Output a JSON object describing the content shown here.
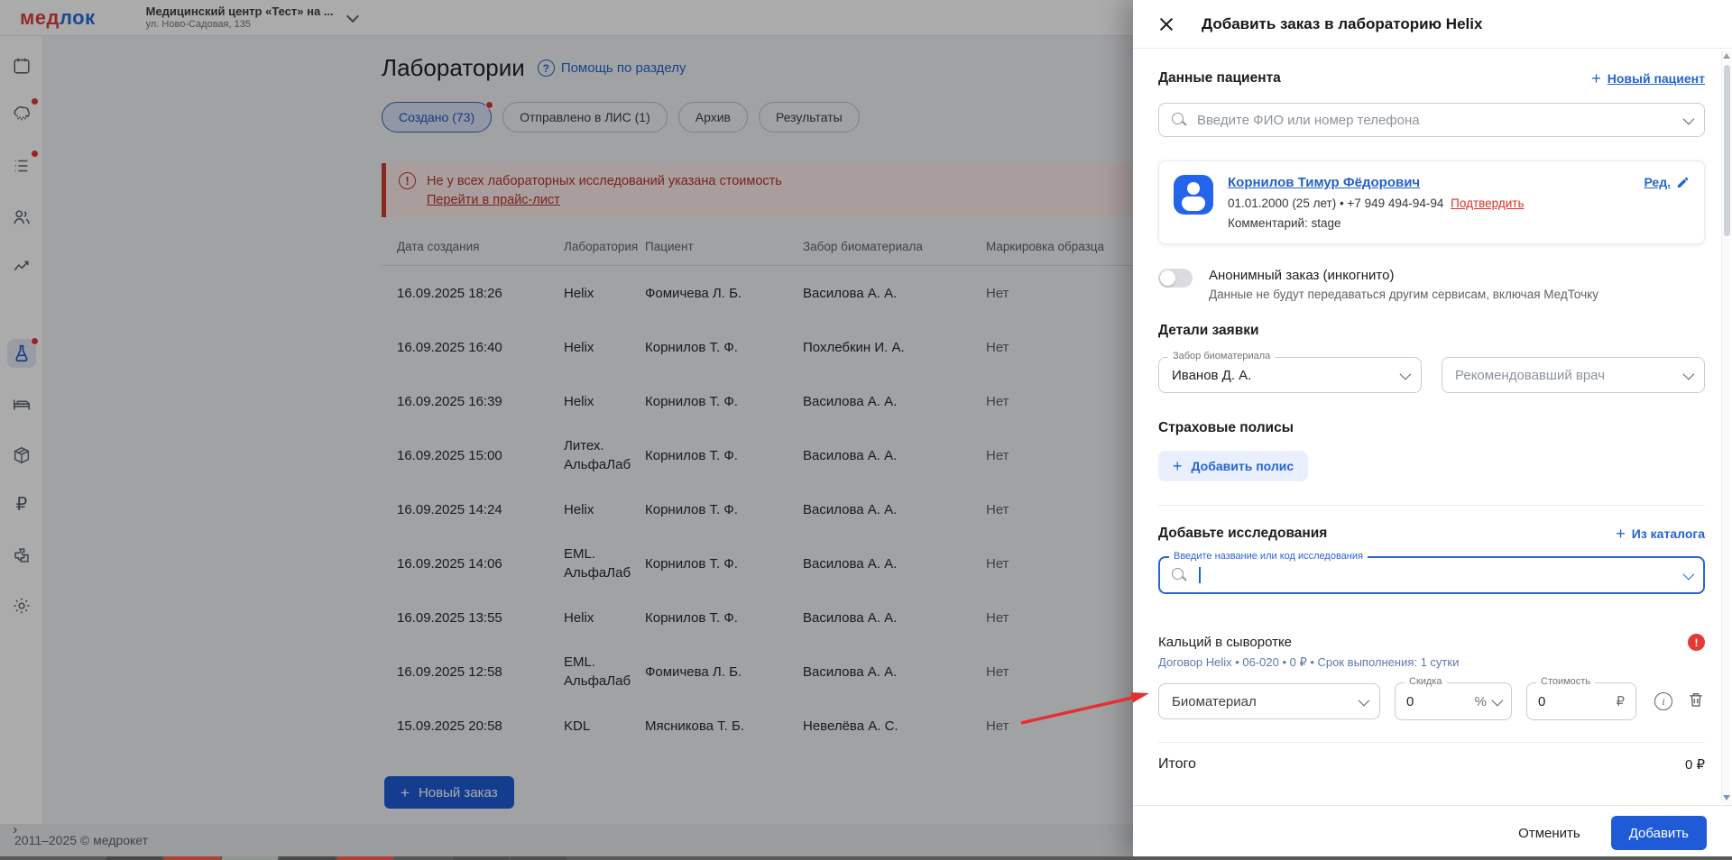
{
  "colors": {
    "accent_blue": "#1f5bd7",
    "link_blue": "#2465d0",
    "danger_red": "#d5372f",
    "logo_red": "#d94141",
    "logo_blue": "#2f6bd8",
    "selected_tab_bg": "#d9e1f5",
    "annotation_arrow": "#e53030"
  },
  "header": {
    "logo_red_part": "мед",
    "logo_blue_part": "лок",
    "clinic_name": "Медицинский центр «Тест» на ...",
    "clinic_address": "ул. Ново-Садовая, 135"
  },
  "sidebar": {
    "items": [
      "calendar",
      "crm",
      "tasks",
      "patients",
      "analytics",
      "laboratory",
      "ward",
      "stock",
      "finance",
      "integrations",
      "settings"
    ],
    "active_item": "laboratory"
  },
  "main": {
    "title": "Лаборатории",
    "help_link": "Помощь по разделу",
    "tabs": [
      {
        "label": "Создано (73)",
        "selected": true,
        "badge": true
      },
      {
        "label": "Отправлено в ЛИС (1)",
        "selected": false
      },
      {
        "label": "Архив",
        "selected": false
      },
      {
        "label": "Результаты",
        "selected": false
      }
    ],
    "warning": {
      "text": "Не у всех лабораторных исследований указана стоимость",
      "link": "Перейти в прайс-лист"
    },
    "table": {
      "columns": [
        "Дата создания",
        "Лаборатория",
        "Пациент",
        "Забор биоматериала",
        "Маркировка образца"
      ],
      "rows": [
        {
          "date": "16.09.2025 18:26",
          "lab": "Helix",
          "patient": "Фомичева Л. Б.",
          "collector": "Василова А. А.",
          "marking": "Нет"
        },
        {
          "date": "16.09.2025 16:40",
          "lab": "Helix",
          "patient": "Корнилов Т. Ф.",
          "collector": "Похлебкин И. А.",
          "marking": "Нет"
        },
        {
          "date": "16.09.2025 16:39",
          "lab": "Helix",
          "patient": "Корнилов Т. Ф.",
          "collector": "Василова А. А.",
          "marking": "Нет"
        },
        {
          "date": "16.09.2025 15:00",
          "lab": "Литех. АльфаЛаб",
          "patient": "Корнилов Т. Ф.",
          "collector": "Василова А. А.",
          "marking": "Нет"
        },
        {
          "date": "16.09.2025 14:24",
          "lab": "Helix",
          "patient": "Корнилов Т. Ф.",
          "collector": "Василова А. А.",
          "marking": "Нет"
        },
        {
          "date": "16.09.2025 14:06",
          "lab": "EML. АльфаЛаб",
          "patient": "Корнилов Т. Ф.",
          "collector": "Василова А. А.",
          "marking": "Нет"
        },
        {
          "date": "16.09.2025 13:55",
          "lab": "Helix",
          "patient": "Корнилов Т. Ф.",
          "collector": "Василова А. А.",
          "marking": "Нет"
        },
        {
          "date": "16.09.2025 12:58",
          "lab": "EML. АльфаЛаб",
          "patient": "Фомичева Л. Б.",
          "collector": "Василова А. А.",
          "marking": "Нет"
        },
        {
          "date": "15.09.2025 20:58",
          "lab": "KDL",
          "patient": "Мясникова Т. Б.",
          "collector": "Невелёва А. С.",
          "marking": "Нет"
        }
      ]
    },
    "new_order_button": "Новый заказ",
    "footer": "2011–2025 © медрокет"
  },
  "drawer": {
    "title": "Добавить заказ в лабораторию Helix",
    "patient": {
      "section_title": "Данные пациента",
      "new_patient_link": "Новый пациент",
      "search_placeholder": "Введите ФИО или номер телефона",
      "card": {
        "name": "Корнилов Тимур Фёдорович",
        "info": "01.01.2000 (25 лет) • +7 949 494-94-94",
        "confirm_link": "Подтвердить",
        "comment": "Комментарий: stage",
        "edit_link": "Ред."
      },
      "anonymous_label": "Анонимный заказ (инкогнито)",
      "anonymous_note": "Данные не будут передаваться другим сервисам, включая МедТочку"
    },
    "details": {
      "section_title": "Детали заявки",
      "biomaterial_label": "Забор биоматериала",
      "biomaterial_value": "Иванов Д. А.",
      "doctor_placeholder": "Рекомендовавший врач"
    },
    "insurance": {
      "section_title": "Страховые полисы",
      "add_button": "Добавить полис"
    },
    "research": {
      "section_title": "Добавьте исследования",
      "catalog_link": "Из каталога",
      "search_label": "Введите название или код исследования",
      "item": {
        "name": "Кальций в сыворотке",
        "meta": "Договор Helix • 06-020 • 0 ₽ • Срок выполнения: 1 сутки",
        "biomaterial_placeholder": "Биоматериал",
        "discount_label": "Скидка",
        "discount_value": "0",
        "discount_unit": "%",
        "cost_label": "Стоимость",
        "cost_value": "0",
        "currency": "₽"
      }
    },
    "total": {
      "label": "Итого",
      "value": "0 ₽"
    },
    "footer": {
      "cancel": "Отменить",
      "submit": "Добавить"
    }
  },
  "taskbar_segments": [
    "#474747",
    "#b0403c",
    "#8f968f",
    "#4a4a4a",
    "#b0403c",
    "#565656",
    "#4e4e4e",
    "#505050"
  ]
}
